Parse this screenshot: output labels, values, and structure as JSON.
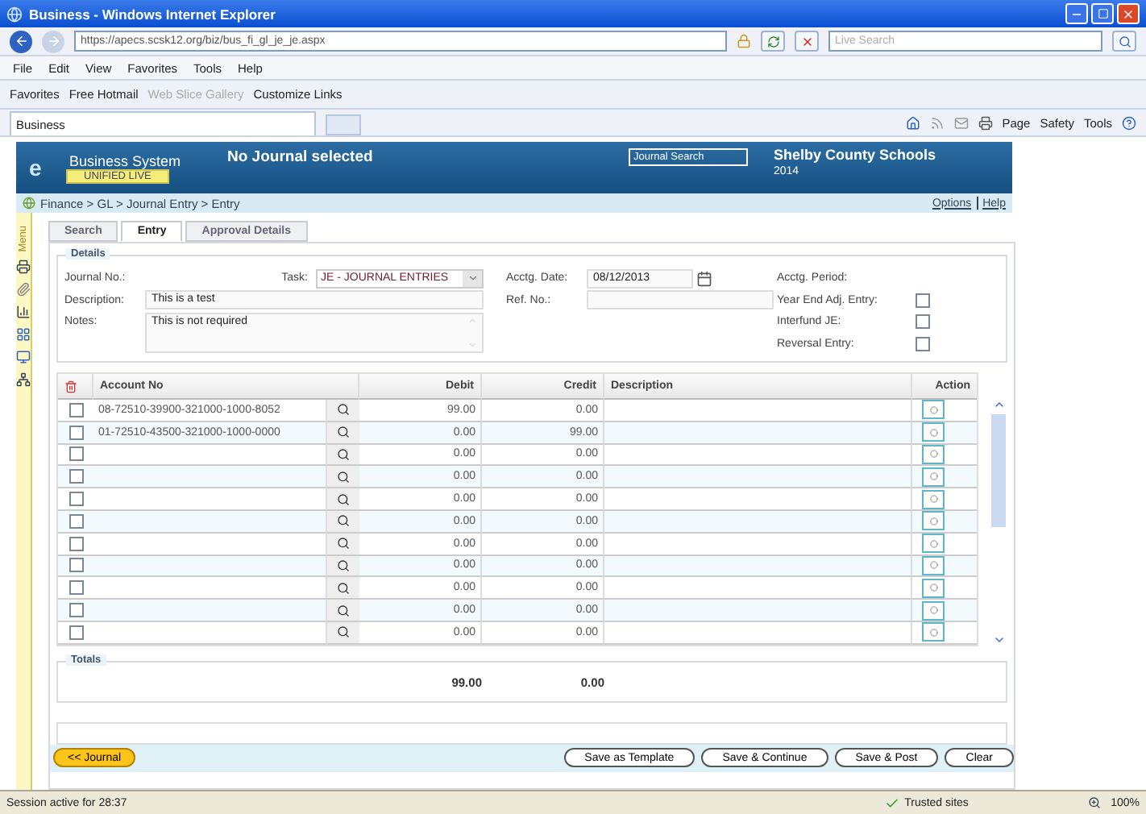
{
  "browser": {
    "title": "Business - Windows Internet Explorer",
    "url": "https://apecs.scsk12.org/biz/bus_fi_gl_je_je.aspx",
    "search_placeholder": "Live Search",
    "menu": [
      "File",
      "Edit",
      "View",
      "Favorites",
      "Tools",
      "Help"
    ],
    "favorites": [
      {
        "label": "Favorites",
        "disabled": false
      },
      {
        "label": "Free Hotmail",
        "disabled": false
      },
      {
        "label": "Web Slice Gallery",
        "disabled": true
      },
      {
        "label": "Customize Links",
        "disabled": false
      }
    ],
    "tab": "Business",
    "commands": [
      "Page",
      "Safety",
      "Tools"
    ]
  },
  "app": {
    "logo": "e",
    "system_name": "Business System",
    "badge": "UNIFIED LIVE",
    "journal_status": "No Journal selected",
    "journal_search": "Journal Search",
    "org": "Shelby County Schools",
    "year": "2014",
    "breadcrumb": "Finance > GL > Journal Entry > Entry",
    "links": [
      "Options",
      "Help"
    ],
    "side_tab": "Menu"
  },
  "tabs": [
    {
      "label": "Search",
      "selected": false
    },
    {
      "label": "Entry",
      "selected": true
    },
    {
      "label": "Approval Details",
      "selected": false
    }
  ],
  "details": {
    "legend": "Details",
    "journal_no": "Journal No.:",
    "task_label": "Task:",
    "task": "JE - JOURNAL ENTRIES",
    "date_label": "Acctg. Date:",
    "date": "08/12/2013",
    "period_label": "Acctg. Period:",
    "description_label": "Description:",
    "description": "This is a test",
    "ref_label": "Ref. No.:",
    "notes_label": "Notes:",
    "notes": "This is not required",
    "checks": [
      {
        "label": "Year End Adj. Entry:",
        "checked": false
      },
      {
        "label": "Interfund JE:",
        "checked": false
      },
      {
        "label": "Reversal Entry:",
        "checked": false
      }
    ]
  },
  "grid": {
    "columns": [
      "Account No",
      "Debit",
      "Credit",
      "Description",
      "Action"
    ],
    "rows": [
      {
        "account": "08-72510-39900-321000-1000-8052",
        "debit": "99.00",
        "credit": "0.00",
        "checked": false
      },
      {
        "account": "01-72510-43500-321000-1000-0000",
        "debit": "0.00",
        "credit": "99.00",
        "checked": false
      },
      {
        "account": "",
        "debit": "0.00",
        "credit": "0.00",
        "checked": false
      },
      {
        "account": "",
        "debit": "0.00",
        "credit": "0.00",
        "checked": false
      },
      {
        "account": "",
        "debit": "0.00",
        "credit": "0.00",
        "checked": false
      },
      {
        "account": "",
        "debit": "0.00",
        "credit": "0.00",
        "checked": false
      },
      {
        "account": "",
        "debit": "0.00",
        "credit": "0.00",
        "checked": false
      },
      {
        "account": "",
        "debit": "0.00",
        "credit": "0.00",
        "checked": false
      },
      {
        "account": "",
        "debit": "0.00",
        "credit": "0.00",
        "checked": false
      },
      {
        "account": "",
        "debit": "0.00",
        "credit": "0.00",
        "checked": false
      },
      {
        "account": "",
        "debit": "0.00",
        "credit": "0.00",
        "checked": false
      }
    ]
  },
  "totals": {
    "legend": "Totals",
    "debit": "99.00",
    "credit": "0.00"
  },
  "back_button": "<< Journal",
  "buttons": [
    "Save as Template",
    "Save & Continue",
    "Save & Post",
    "Clear"
  ],
  "status": {
    "text": "Session active for 28:37",
    "zone": "Trusted sites",
    "zoom": "100%"
  }
}
